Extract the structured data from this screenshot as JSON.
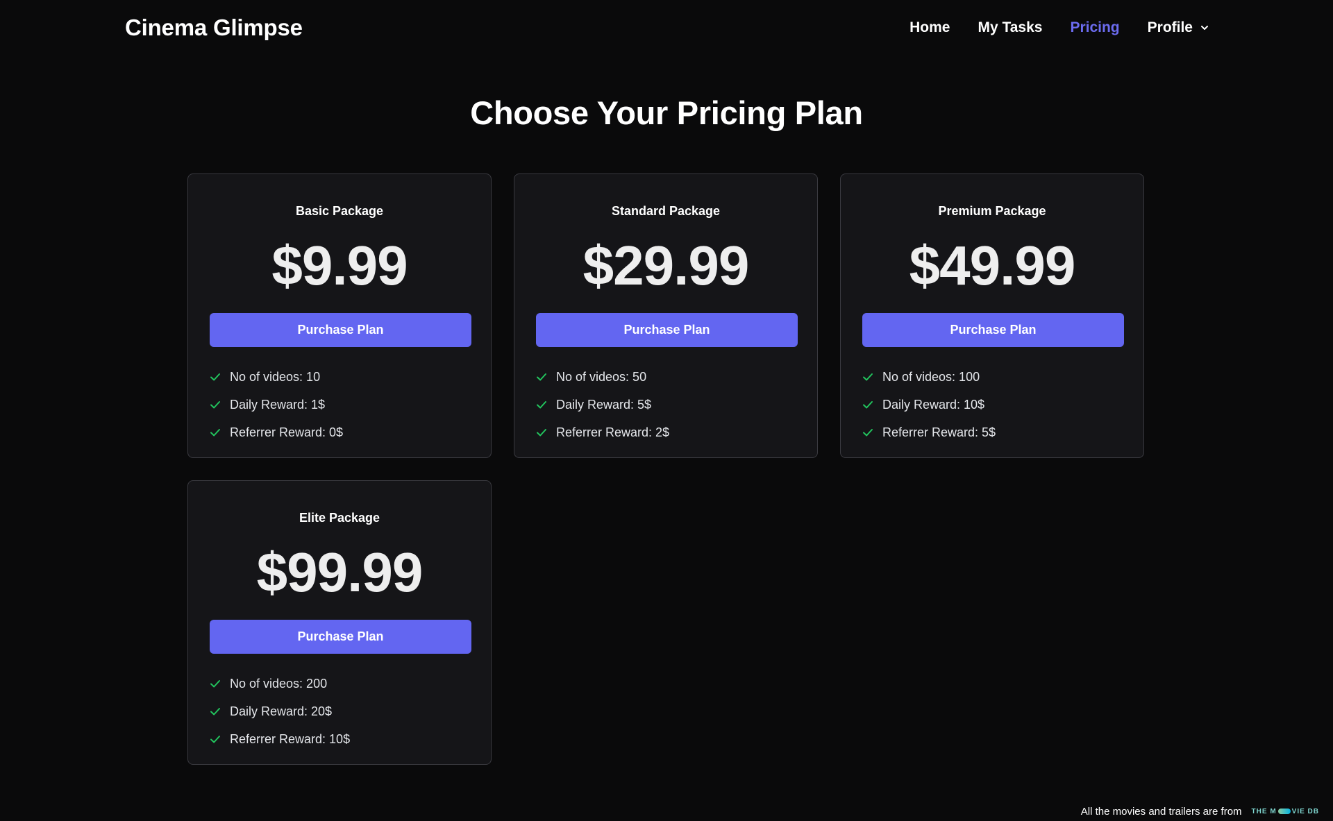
{
  "brand": "Cinema Glimpse",
  "nav": {
    "home": "Home",
    "tasks": "My Tasks",
    "pricing": "Pricing",
    "profile": "Profile",
    "active": "Pricing"
  },
  "heading": "Choose Your Pricing Plan",
  "plans": [
    {
      "name": "Basic Package",
      "price": "$9.99",
      "button": "Purchase Plan",
      "features": [
        "No of videos: 10",
        "Daily Reward: 1$",
        "Referrer Reward: 0$"
      ]
    },
    {
      "name": "Standard Package",
      "price": "$29.99",
      "button": "Purchase Plan",
      "features": [
        "No of videos: 50",
        "Daily Reward: 5$",
        "Referrer Reward: 2$"
      ]
    },
    {
      "name": "Premium Package",
      "price": "$49.99",
      "button": "Purchase Plan",
      "features": [
        "No of videos: 100",
        "Daily Reward: 10$",
        "Referrer Reward: 5$"
      ]
    },
    {
      "name": "Elite Package",
      "price": "$99.99",
      "button": "Purchase Plan",
      "features": [
        "No of videos: 200",
        "Daily Reward: 20$",
        "Referrer Reward: 10$"
      ]
    }
  ],
  "footer": {
    "text": "All the movies and trailers are from",
    "logo_left": "THE M",
    "logo_right": "VIE DB"
  },
  "colors": {
    "background": "#0a0a0b",
    "card": "#151518",
    "accent": "#6366f1",
    "active_link": "#6c6cf0",
    "check": "#22c55e"
  },
  "icons": {
    "check": "check-icon",
    "chevron": "chevron-down-icon"
  }
}
